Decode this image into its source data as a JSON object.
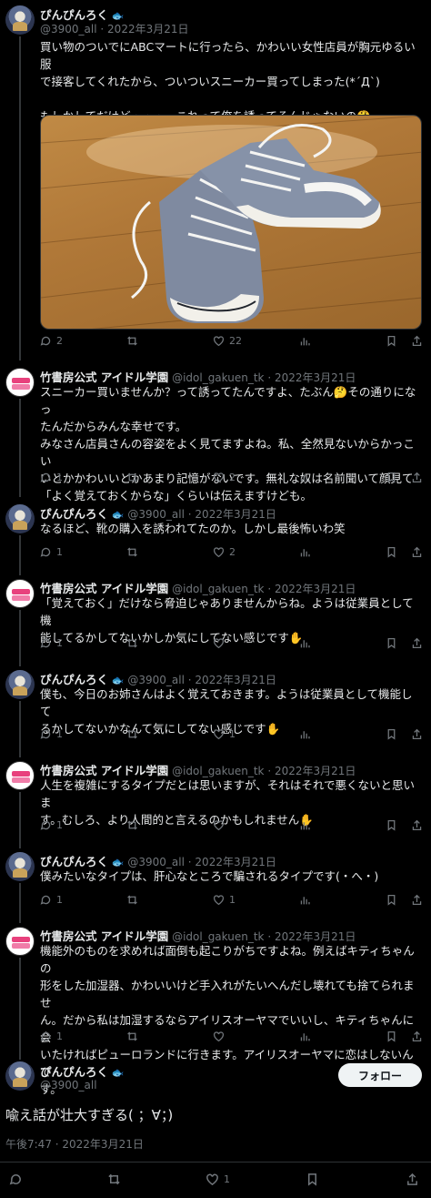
{
  "pin": {
    "name": "ぴんぴんろく",
    "fish": "🐟",
    "handle": "@3900_all"
  },
  "idol": {
    "name": "竹書房公式 アイドル学園",
    "handle": "@idol_gakuen_tk"
  },
  "dot": "·",
  "tweets": [
    {
      "date": "2022年3月21日",
      "text": "買い物のついでにABCマートに行ったら、かわいい女性店員が胸元ゆるい服\nで接客してくれたから、ついついスニーカー買ってしまった(*´Д`)\n\nもしかしてだけど・・・、これって俺を誘ってるんじゃないの🤔",
      "replies": "2",
      "retweets": "",
      "likes": "22"
    },
    {
      "date": "2022年3月21日",
      "text": "スニーカー買いませんか？って誘ってたんですよ、たぶん🤔その通りになっ\nたんだからみんな幸せです。\nみなさん店員さんの容姿をよく見てますよね。私、全然見ないからかっこい\nいとかかわいいとかあまり記憶がないです。無礼な奴は名前聞いて顔見て\n「よく覚えておくからな」くらいは伝えますけども。",
      "replies": "1",
      "retweets": "",
      "likes": "2"
    },
    {
      "date": "2022年3月21日",
      "text": "なるほど、靴の購入を誘われてたのか。しかし最後怖いわ笑",
      "replies": "1",
      "retweets": "",
      "likes": "2"
    },
    {
      "date": "2022年3月21日",
      "text": "「覚えておく」だけなら脅迫じゃありませんからね。ようは従業員として機\n能してるかしてないかしか気にしてない感じです✋",
      "replies": "1",
      "retweets": "",
      "likes": ""
    },
    {
      "date": "2022年3月21日",
      "text": "僕も、今日のお姉さんはよく覚えておきます。ようは従業員として機能して\nるかしてないかなんて気にしてない感じです✋",
      "replies": "1",
      "retweets": "",
      "likes": "1"
    },
    {
      "date": "2022年3月21日",
      "text": "人生を複雑にするタイプだとは思いますが、それはそれで悪くないと思いま\nす。むしろ、より人間的と言えるのかもしれません✋",
      "replies": "1",
      "retweets": "",
      "likes": ""
    },
    {
      "date": "2022年3月21日",
      "text": "僕みたいなタイプは、肝心なところで騙されるタイプです(・へ・)",
      "replies": "1",
      "retweets": "",
      "likes": "1"
    },
    {
      "date": "2022年3月21日",
      "text": "機能外のものを求めれば面倒も起こりがちですよね。例えばキティちゃんの\n形をした加湿器、かわいいけど手入れがたいへんだし壊れても捨てられませ\nん。だから私は加湿するならアイリスオーヤマでいいし、キティちゃんに会\nいたければピューロランドに行きます。アイリスオーヤマに恋はしないんで\nす。",
      "replies": "1",
      "retweets": "",
      "likes": ""
    }
  ],
  "main": {
    "follow_label": "フォロー",
    "text": "喩え話が壮大すぎる( ；∀；)",
    "timestamp": "午後7:47 · 2022年3月21日",
    "likes": "1"
  }
}
